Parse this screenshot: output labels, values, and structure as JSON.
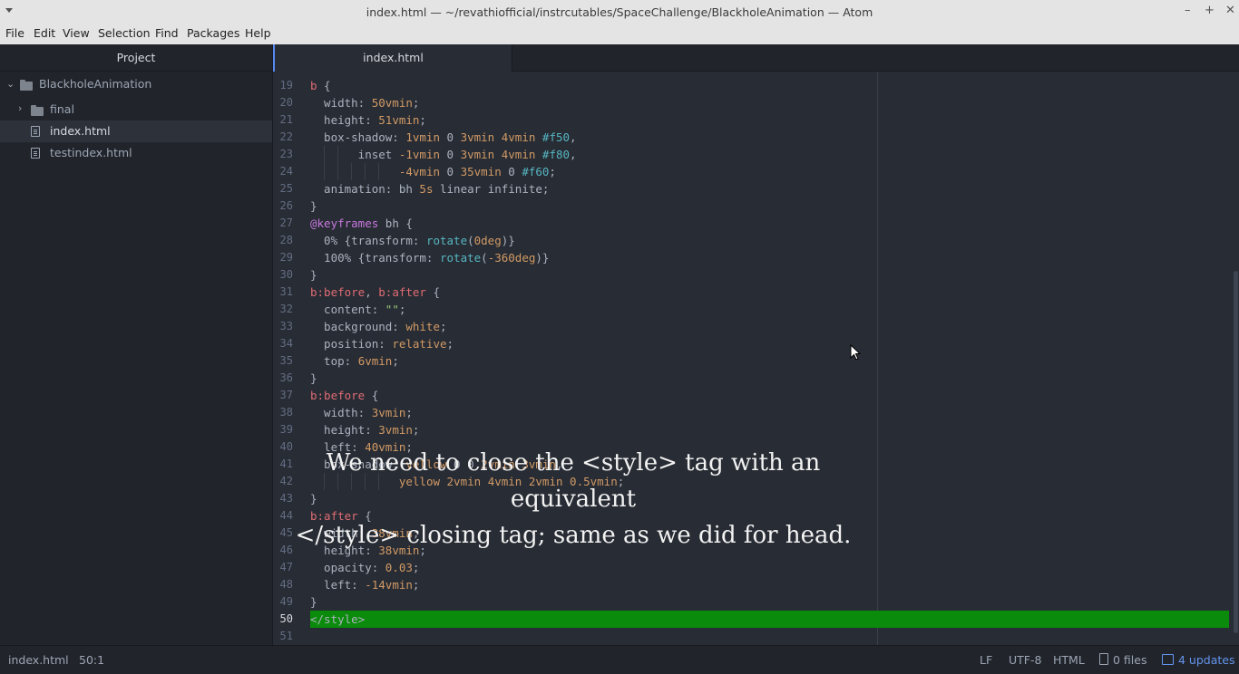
{
  "window": {
    "title": "index.html — ~/revathiofficial/instrcutables/SpaceChallenge/BlackholeAnimation — Atom",
    "minimize": "–",
    "maximize": "+",
    "close": "✕"
  },
  "menubar": [
    "File",
    "Edit",
    "View",
    "Selection",
    "Find",
    "Packages",
    "Help"
  ],
  "sidebar": {
    "title": "Project",
    "root": "BlackholeAnimation",
    "items": [
      {
        "label": "final",
        "type": "folder"
      },
      {
        "label": "index.html",
        "type": "file",
        "selected": true
      },
      {
        "label": "testindex.html",
        "type": "file"
      }
    ]
  },
  "tabs": [
    {
      "label": "index.html",
      "active": true
    }
  ],
  "editor": {
    "current_line": 50,
    "lines": [
      {
        "n": 19,
        "code": "b {"
      },
      {
        "n": 20,
        "code": "  width: 50vmin;"
      },
      {
        "n": 21,
        "code": "  height: 51vmin;"
      },
      {
        "n": 22,
        "code": "  box-shadow: 1vmin 0 3vmin 4vmin #f50,"
      },
      {
        "n": 23,
        "code": "       inset -1vmin 0 3vmin 4vmin #f80,"
      },
      {
        "n": 24,
        "code": "             -4vmin 0 35vmin 0 #f60;"
      },
      {
        "n": 25,
        "code": "  animation: bh 5s linear infinite;"
      },
      {
        "n": 26,
        "code": "}"
      },
      {
        "n": 27,
        "code": "@keyframes bh {"
      },
      {
        "n": 28,
        "code": "  0% {transform: rotate(0deg)}"
      },
      {
        "n": 29,
        "code": "  100% {transform: rotate(-360deg)}"
      },
      {
        "n": 30,
        "code": "}"
      },
      {
        "n": 31,
        "code": "b:before, b:after {"
      },
      {
        "n": 32,
        "code": "  content: \"\";"
      },
      {
        "n": 33,
        "code": "  background: white;"
      },
      {
        "n": 34,
        "code": "  position: relative;"
      },
      {
        "n": 35,
        "code": "  top: 6vmin;"
      },
      {
        "n": 36,
        "code": "}"
      },
      {
        "n": 37,
        "code": "b:before {"
      },
      {
        "n": 38,
        "code": "  width: 3vmin;"
      },
      {
        "n": 39,
        "code": "  height: 3vmin;"
      },
      {
        "n": 40,
        "code": "  left: 40vmin;"
      },
      {
        "n": 41,
        "code": "  box-shadow: yellow 0 0 2vmin 3vmin,"
      },
      {
        "n": 42,
        "code": "             yellow 2vmin 4vmin 2vmin 0.5vmin;"
      },
      {
        "n": 43,
        "code": "}"
      },
      {
        "n": 44,
        "code": "b:after {"
      },
      {
        "n": 45,
        "code": "  width: 38vmin;"
      },
      {
        "n": 46,
        "code": "  height: 38vmin;"
      },
      {
        "n": 47,
        "code": "  opacity: 0.03;"
      },
      {
        "n": 48,
        "code": "  left: -14vmin;"
      },
      {
        "n": 49,
        "code": "}"
      },
      {
        "n": 50,
        "code": "</style>"
      },
      {
        "n": 51,
        "code": ""
      }
    ]
  },
  "caption": {
    "line1": "We need to close the <style> tag with an equivalent",
    "line2": "</style> closing tag; same as we did for head."
  },
  "statusbar": {
    "file": "index.html",
    "cursor": "50:1",
    "line_ending": "LF",
    "encoding": "UTF-8",
    "grammar": "HTML",
    "git_files": "0 files",
    "updates": "4 updates"
  },
  "colors": {
    "highlight": "#0b8b0b",
    "accent": "#568af2"
  }
}
